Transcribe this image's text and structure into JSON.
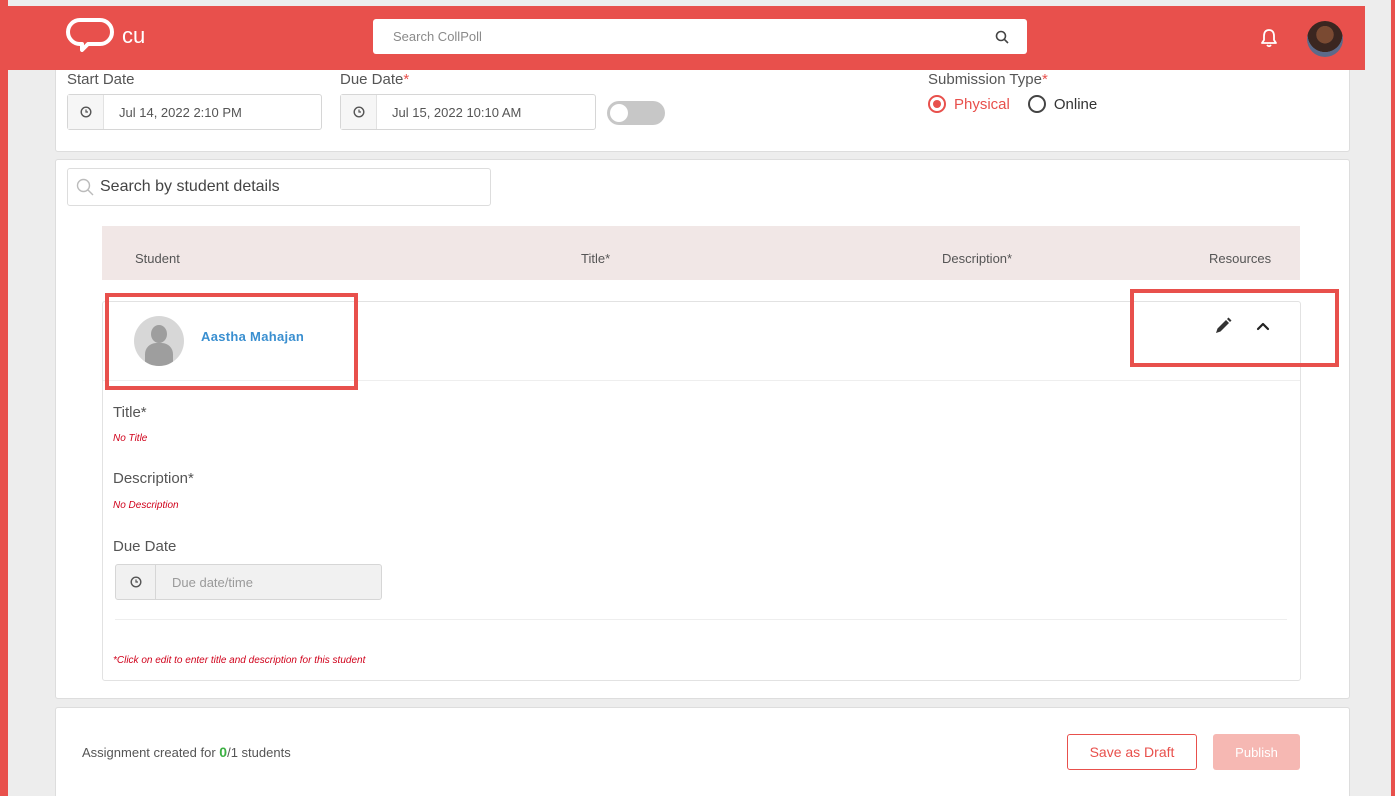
{
  "header": {
    "brand": "cu",
    "search_placeholder": "Search CollPoll"
  },
  "form": {
    "start_date_label": "Start Date",
    "start_date_value": "Jul 14, 2022 2:10 PM",
    "due_date_label": "Due Date",
    "due_date_value": "Jul 15, 2022 10:10 AM",
    "required_mark": "*",
    "submission_type_label": "Submission Type",
    "submission_options": [
      "Physical",
      "Online"
    ],
    "submission_selected": "Physical"
  },
  "students": {
    "search_placeholder": "Search by student details",
    "columns": [
      "Student",
      "Title*",
      "Description*",
      "Resources"
    ],
    "rows": [
      {
        "name": "Aastha Mahajan",
        "title_label": "Title*",
        "title_value": "No Title",
        "description_label": "Description*",
        "description_value": "No Description",
        "due_date_label": "Due Date",
        "due_date_placeholder": "Due date/time",
        "note": "*Click on edit to enter title and description for this student"
      }
    ]
  },
  "footer": {
    "assign_prefix": "Assignment created for ",
    "assign_count": "0",
    "assign_suffix": "/1 students",
    "save_draft_label": "Save as Draft",
    "publish_label": "Publish"
  },
  "colors": {
    "brand": "#e8504c",
    "link": "#3a8fd0",
    "error": "#d0021b",
    "success": "#3cb043"
  }
}
